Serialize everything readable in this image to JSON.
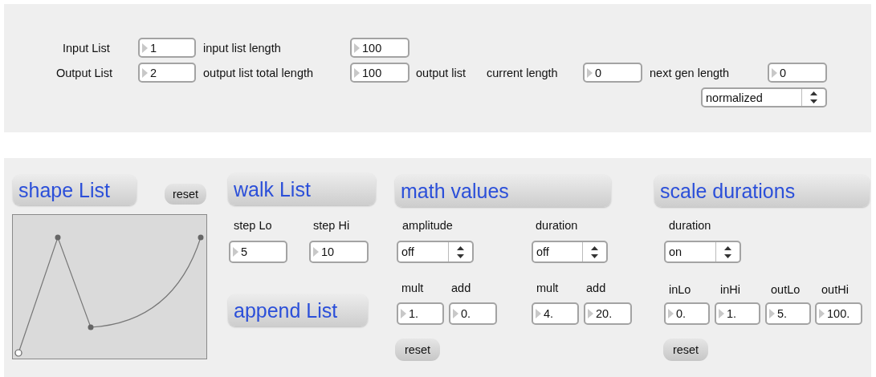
{
  "top_panel": {
    "items": [
      {
        "kind": "label",
        "text": "Input List"
      },
      {
        "kind": "number",
        "value": "1"
      },
      {
        "kind": "label",
        "text": "input list length"
      },
      {
        "kind": "number",
        "value": "100"
      },
      {
        "kind": "label",
        "text": "Output List"
      },
      {
        "kind": "number",
        "value": "2"
      },
      {
        "kind": "label",
        "text": "output list total length"
      },
      {
        "kind": "number",
        "value": "100"
      },
      {
        "kind": "label",
        "text": "output list"
      },
      {
        "kind": "label",
        "text": "current length"
      },
      {
        "kind": "number",
        "value": "0"
      },
      {
        "kind": "label",
        "text": "next gen length"
      },
      {
        "kind": "number",
        "value": "0"
      },
      {
        "kind": "menu",
        "value": "normalized"
      }
    ]
  },
  "bottom_panel": {
    "items": [
      {
        "kind": "title",
        "text": "shape List"
      },
      {
        "kind": "button",
        "text": "reset"
      },
      {
        "kind": "graph"
      },
      {
        "kind": "title",
        "text": "walk List"
      },
      {
        "kind": "label",
        "text": "step Lo"
      },
      {
        "kind": "label",
        "text": "step Hi"
      },
      {
        "kind": "number",
        "value": "5"
      },
      {
        "kind": "number",
        "value": "10"
      },
      {
        "kind": "title",
        "text": "append List"
      },
      {
        "kind": "title",
        "text": "math values"
      },
      {
        "kind": "label",
        "text": "amplitude"
      },
      {
        "kind": "label",
        "text": "duration"
      },
      {
        "kind": "menu",
        "value": "off"
      },
      {
        "kind": "menu",
        "value": "off"
      },
      {
        "kind": "label",
        "text": "mult"
      },
      {
        "kind": "label",
        "text": "add"
      },
      {
        "kind": "label",
        "text": "mult"
      },
      {
        "kind": "label",
        "text": "add"
      },
      {
        "kind": "number",
        "value": "1."
      },
      {
        "kind": "number",
        "value": "0."
      },
      {
        "kind": "number",
        "value": "4."
      },
      {
        "kind": "number",
        "value": "20."
      },
      {
        "kind": "button",
        "text": "reset"
      },
      {
        "kind": "title",
        "text": "scale durations"
      },
      {
        "kind": "label",
        "text": "duration"
      },
      {
        "kind": "menu",
        "value": "on"
      },
      {
        "kind": "label",
        "text": "inLo"
      },
      {
        "kind": "label",
        "text": "inHi"
      },
      {
        "kind": "label",
        "text": "outLo"
      },
      {
        "kind": "label",
        "text": "outHi"
      },
      {
        "kind": "number",
        "value": "0."
      },
      {
        "kind": "number",
        "value": "1."
      },
      {
        "kind": "number",
        "value": "5."
      },
      {
        "kind": "number",
        "value": "100."
      },
      {
        "kind": "button",
        "text": "reset"
      }
    ]
  }
}
